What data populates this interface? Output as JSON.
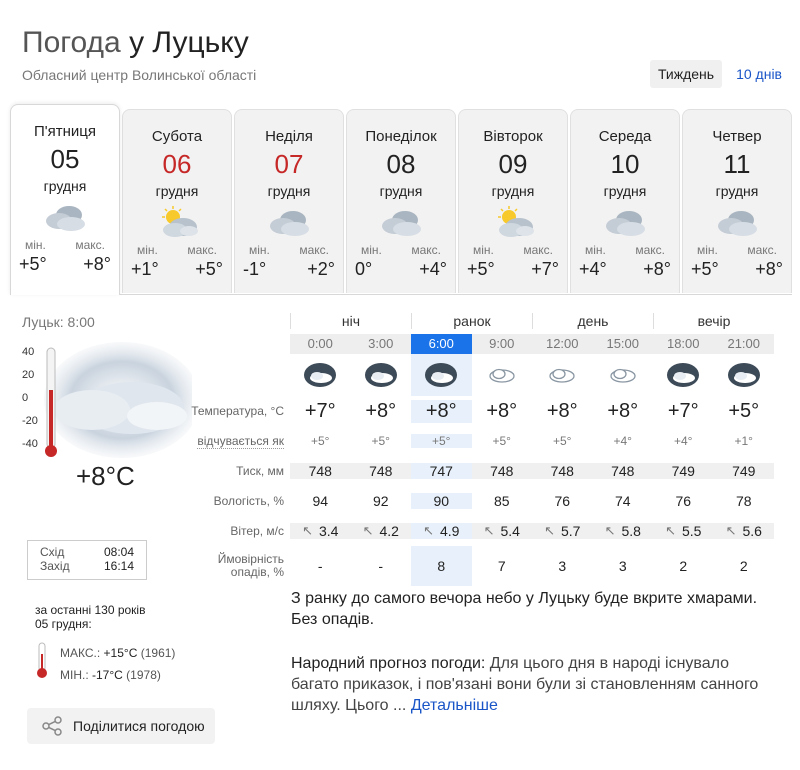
{
  "header": {
    "title_prefix": "Погода",
    "title_city": "у Луцьку",
    "subtitle": "Обласний центр Волинської області",
    "period_week": "Тиждень",
    "period_10days": "10 днів"
  },
  "days": [
    {
      "day": "П'ятниця",
      "num": "05",
      "month": "грудня",
      "icon": "cloudy-icon",
      "min_label": "мін.",
      "max_label": "макс.",
      "min": "+5°",
      "max": "+8°",
      "weekend": false,
      "active": true
    },
    {
      "day": "Субота",
      "num": "06",
      "month": "грудня",
      "icon": "partly-sunny-icon",
      "min_label": "мін.",
      "max_label": "макс.",
      "min": "+1°",
      "max": "+5°",
      "weekend": true,
      "active": false
    },
    {
      "day": "Неділя",
      "num": "07",
      "month": "грудня",
      "icon": "cloudy-icon",
      "min_label": "мін.",
      "max_label": "макс.",
      "min": "-1°",
      "max": "+2°",
      "weekend": true,
      "active": false
    },
    {
      "day": "Понеділок",
      "num": "08",
      "month": "грудня",
      "icon": "cloudy-icon",
      "min_label": "мін.",
      "max_label": "макс.",
      "min": "0°",
      "max": "+4°",
      "weekend": false,
      "active": false
    },
    {
      "day": "Вівторок",
      "num": "09",
      "month": "грудня",
      "icon": "partly-sunny-icon",
      "min_label": "мін.",
      "max_label": "макс.",
      "min": "+5°",
      "max": "+7°",
      "weekend": false,
      "active": false
    },
    {
      "day": "Середа",
      "num": "10",
      "month": "грудня",
      "icon": "cloudy-icon",
      "min_label": "мін.",
      "max_label": "макс.",
      "min": "+4°",
      "max": "+8°",
      "weekend": false,
      "active": false
    },
    {
      "day": "Четвер",
      "num": "11",
      "month": "грудня",
      "icon": "cloudy-icon",
      "min_label": "мін.",
      "max_label": "макс.",
      "min": "+5°",
      "max": "+8°",
      "weekend": false,
      "active": false
    }
  ],
  "current": {
    "location_time": "Луцьк: 8:00",
    "scale": [
      "40",
      "20",
      "0",
      "-20",
      "-40"
    ],
    "temp": "+8°C",
    "sunrise_label": "Схід",
    "sunrise": "08:04",
    "sunset_label": "Захід",
    "sunset": "16:14"
  },
  "history": {
    "line1": "за останні 130 років",
    "line2": "05 грудня:",
    "max_label": "МАКС.:",
    "max_value": "+15°C",
    "max_year": "(1961)",
    "min_label": "МІН.:",
    "min_value": "-17°C",
    "min_year": "(1978)"
  },
  "share_label": "Поділитися погодою",
  "hourly": {
    "groups": [
      "ніч",
      "ранок",
      "день",
      "вечір"
    ],
    "times": [
      "0:00",
      "3:00",
      "6:00",
      "9:00",
      "12:00",
      "15:00",
      "18:00",
      "21:00"
    ],
    "icons": [
      "night-cloudy-icon",
      "night-cloudy-icon",
      "night-cloudy-icon",
      "cloud-icon",
      "cloud-icon",
      "cloud-icon",
      "night-cloudy-icon",
      "night-cloudy-icon"
    ],
    "labels": {
      "temp": "Температура, °C",
      "feels": "відчувається як",
      "pressure": "Тиск, мм",
      "humidity": "Вологість, %",
      "wind": "Вітер, м/с",
      "precip_1": "Ймовірність",
      "precip_2": "опадів, %"
    },
    "temp": [
      "+7°",
      "+8°",
      "+8°",
      "+8°",
      "+8°",
      "+8°",
      "+7°",
      "+5°"
    ],
    "feels": [
      "+5°",
      "+5°",
      "+5°",
      "+5°",
      "+5°",
      "+4°",
      "+4°",
      "+1°"
    ],
    "pressure": [
      "748",
      "748",
      "747",
      "748",
      "748",
      "748",
      "749",
      "749"
    ],
    "humidity": [
      "94",
      "92",
      "90",
      "85",
      "76",
      "74",
      "76",
      "78"
    ],
    "wind_arrow": "↖",
    "wind": [
      "3.4",
      "4.2",
      "4.9",
      "5.4",
      "5.7",
      "5.8",
      "5.5",
      "5.6"
    ],
    "precip": [
      "-",
      "-",
      "8",
      "7",
      "3",
      "3",
      "2",
      "2"
    ]
  },
  "description": "З ранку до самого вечора небо у Луцьку буде вкрите хмарами. Без опадів.",
  "folk": {
    "lead": "Народний прогноз погоди:",
    "text": " Для цього дня в народі існувало багато приказок, і пов'язані вони були зі становленням санного шляху. Цього ... ",
    "link": "Детальніше"
  },
  "colors": {
    "accent": "#1a73e8",
    "link": "#1a55c8",
    "weekend": "#c62828",
    "highlight": "#e8f1fb"
  }
}
